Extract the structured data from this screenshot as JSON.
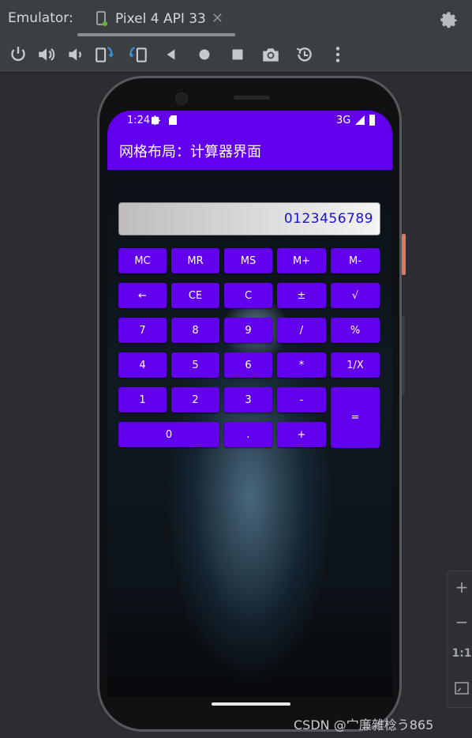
{
  "emulator": {
    "label": "Emulator:",
    "tab_title": "Pixel 4 API 33",
    "tab_close": "✕"
  },
  "toolbar": {
    "icons": [
      "power-icon",
      "volume-up-icon",
      "volume-down-icon",
      "rotate-left-icon",
      "rotate-right-icon",
      "back-icon",
      "home-icon",
      "overview-icon",
      "camera-icon",
      "replay-icon",
      "more-icon"
    ]
  },
  "phone": {
    "status": {
      "time": "1:24",
      "network": "3G"
    },
    "app_title": "网格布局：计算器界面",
    "display_value": "0123456789",
    "keys": {
      "mc": "MC",
      "mr": "MR",
      "ms": "MS",
      "mplus": "M+",
      "mminus": "M-",
      "back": "←",
      "ce": "CE",
      "c": "C",
      "plusminus": "±",
      "sqrt": "√",
      "k7": "7",
      "k8": "8",
      "k9": "9",
      "div": "/",
      "pct": "%",
      "k4": "4",
      "k5": "5",
      "k6": "6",
      "mul": "*",
      "inv": "1/X",
      "k1": "1",
      "k2": "2",
      "k3": "3",
      "minus": "-",
      "eq": "=",
      "k0": "0",
      "dot": ".",
      "plus": "+"
    }
  },
  "zoom": {
    "plus": "+",
    "minus": "−",
    "one_to_one": "1:1"
  },
  "watermark": "CSDN @宀廉雜棯う865",
  "colors": {
    "accent": "#6200ee",
    "display_text": "#1a13c9",
    "side_button": "#e07a5f"
  }
}
